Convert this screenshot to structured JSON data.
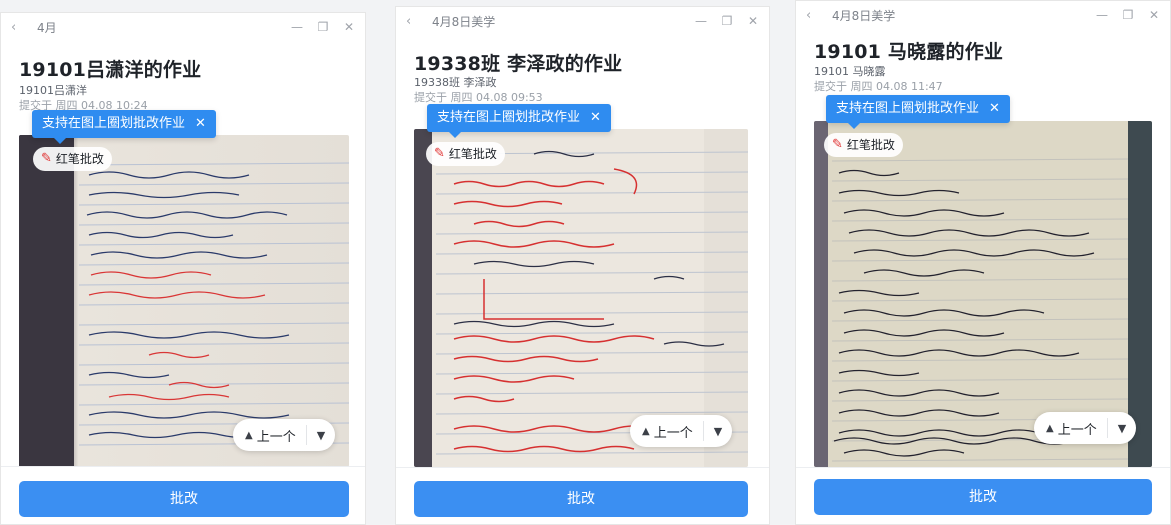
{
  "panels": [
    {
      "crumb": "4月",
      "title": "19101吕潇洋的作业",
      "sub": "19101吕潇洋",
      "time": "提交于 周四 04.08 10:24",
      "tip": "支持在图上圈划批改作业",
      "redpen": "红笔批改",
      "prev": "上一个",
      "grade": "批改"
    },
    {
      "crumb": "4月8日美学",
      "title": "19338班 李泽政的作业",
      "sub": "19338班 李泽政",
      "time": "提交于 周四 04.08 09:53",
      "tip": "支持在图上圈划批改作业",
      "redpen": "红笔批改",
      "prev": "上一个",
      "grade": "批改"
    },
    {
      "crumb": "4月8日美学",
      "title": "19101 马晓露的作业",
      "sub": "19101 马晓露",
      "time": "提交于 周四 04.08 11:47",
      "tip": "支持在图上圈划批改作业",
      "redpen": "红笔批改",
      "prev": "上一个",
      "grade": "批改"
    }
  ],
  "icons": {
    "back": "chevron-left-icon",
    "minimize": "minimize-icon",
    "restore": "restore-icon",
    "close": "close-icon",
    "pen": "red-pen-icon",
    "up": "triangle-up-icon",
    "down": "triangle-down-icon"
  },
  "colors": {
    "accent": "#3b8ff2",
    "tip": "#2f8cf0",
    "pen": "#e03131"
  }
}
